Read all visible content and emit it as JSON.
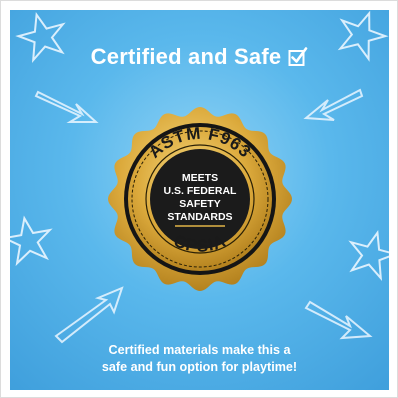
{
  "banner": {
    "headline": "Certified and Safe",
    "headline_icon": "checkbox-check-icon",
    "badge": {
      "top_arc_text": "ASTM F963",
      "center_lines": [
        "MEETS",
        "U.S. FEDERAL",
        "SAFETY",
        "STANDARDS"
      ],
      "bottom_arc_text": "CPSIA"
    },
    "caption_lines": [
      "Certified materials make this a",
      "safe and fun option for playtime!"
    ],
    "decorations": [
      "star-icon",
      "arrow-icon",
      "star-icon",
      "arrow-icon",
      "star-icon",
      "star-icon",
      "arrow-icon",
      "arrow-icon"
    ]
  },
  "colors": {
    "background": "#5ab8ec",
    "gold": "#d4a334",
    "badge_center": "#1a1a1a",
    "text": "#ffffff"
  }
}
